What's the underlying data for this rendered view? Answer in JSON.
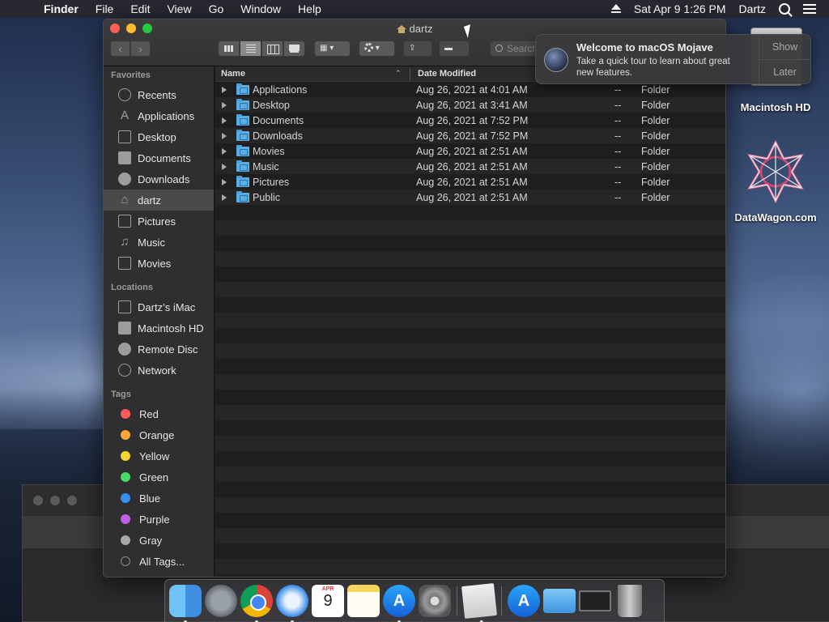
{
  "menubar": {
    "app": "Finder",
    "items": [
      "File",
      "Edit",
      "View",
      "Go",
      "Window",
      "Help"
    ],
    "clock": "Sat Apr 9  1:26 PM",
    "user": "Dartz"
  },
  "window": {
    "title": "dartz",
    "search_placeholder": "Search"
  },
  "sidebar": {
    "favorites_header": "Favorites",
    "favorites": [
      "Recents",
      "Applications",
      "Desktop",
      "Documents",
      "Downloads",
      "dartz",
      "Pictures",
      "Music",
      "Movies"
    ],
    "locations_header": "Locations",
    "locations": [
      "Dartz’s iMac",
      "Macintosh HD",
      "Remote Disc",
      "Network"
    ],
    "tags_header": "Tags",
    "tags": [
      {
        "label": "Red",
        "color": "#ff5b5b"
      },
      {
        "label": "Orange",
        "color": "#ffa53a"
      },
      {
        "label": "Yellow",
        "color": "#f5d630"
      },
      {
        "label": "Green",
        "color": "#4cd964"
      },
      {
        "label": "Blue",
        "color": "#3a8ef0"
      },
      {
        "label": "Purple",
        "color": "#c060e0"
      },
      {
        "label": "Gray",
        "color": "#a8a8a8"
      },
      {
        "label": "All Tags...",
        "color": ""
      }
    ]
  },
  "list": {
    "columns": {
      "name": "Name",
      "date": "Date Modified"
    },
    "rows": [
      {
        "name": "Applications",
        "date": "Aug 26, 2021 at 4:01 AM",
        "size": "--",
        "kind": "Folder"
      },
      {
        "name": "Desktop",
        "date": "Aug 26, 2021 at 3:41 AM",
        "size": "--",
        "kind": "Folder"
      },
      {
        "name": "Documents",
        "date": "Aug 26, 2021 at 7:52 PM",
        "size": "--",
        "kind": "Folder"
      },
      {
        "name": "Downloads",
        "date": "Aug 26, 2021 at 7:52 PM",
        "size": "--",
        "kind": "Folder"
      },
      {
        "name": "Movies",
        "date": "Aug 26, 2021 at 2:51 AM",
        "size": "--",
        "kind": "Folder"
      },
      {
        "name": "Music",
        "date": "Aug 26, 2021 at 2:51 AM",
        "size": "--",
        "kind": "Folder"
      },
      {
        "name": "Pictures",
        "date": "Aug 26, 2021 at 2:51 AM",
        "size": "--",
        "kind": "Folder"
      },
      {
        "name": "Public",
        "date": "Aug 26, 2021 at 2:51 AM",
        "size": "--",
        "kind": "Folder"
      }
    ]
  },
  "notification": {
    "title": "Welcome to macOS Mojave",
    "body": "Take a quick tour to learn about great new features.",
    "show": "Show",
    "later": "Later"
  },
  "desktop": {
    "hd_label": "Macintosh HD",
    "logo_label": "DataWagon.com"
  },
  "dock": {
    "calendar_month": "APR",
    "calendar_day": "9"
  }
}
